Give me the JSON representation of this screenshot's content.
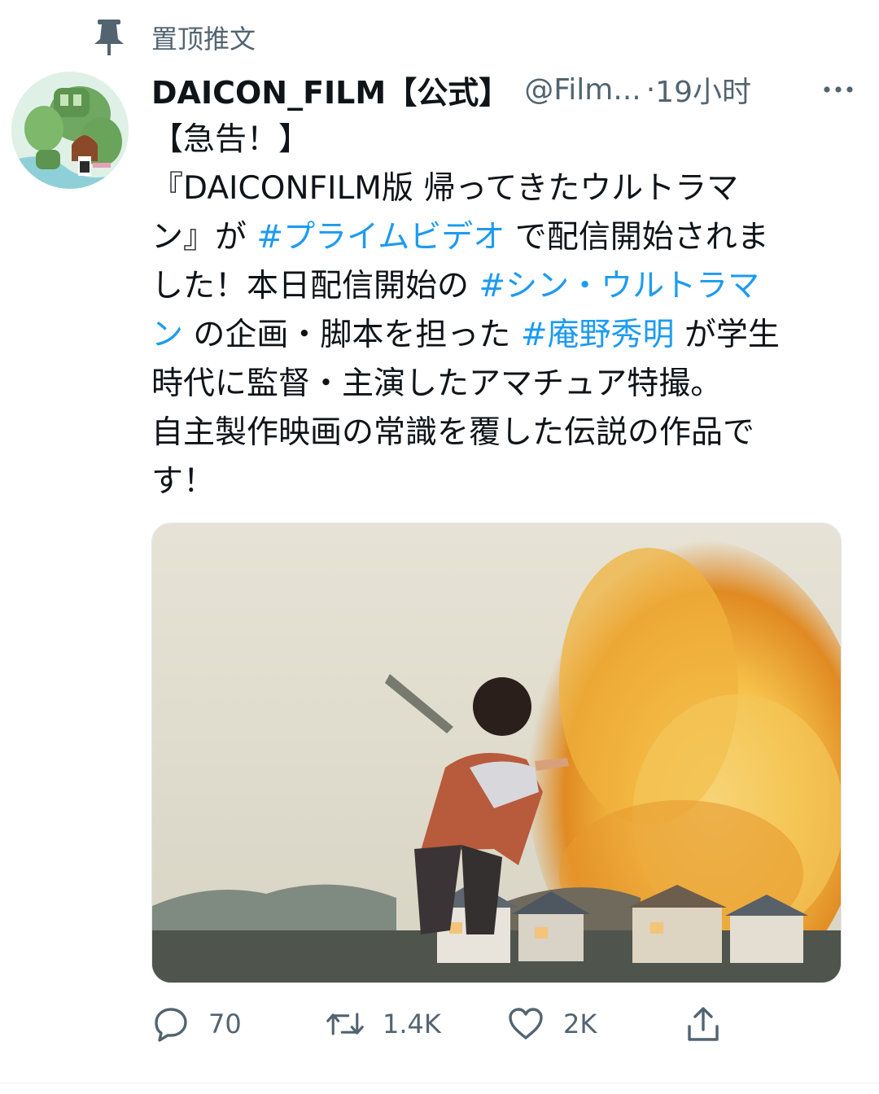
{
  "pinned": {
    "label": "置顶推文",
    "icon": "pin-icon"
  },
  "tweet": {
    "author": {
      "display_name": "DAICON_FILM【公式】",
      "handle": "@Film...",
      "avatar_icon": "avatar"
    },
    "separator": "·",
    "time": "19小时",
    "more_icon": "more-icon",
    "text_lines": [
      [
        {
          "t": "【急告！】"
        }
      ],
      [
        {
          "t": "『DAICONFILM版 帰ってきたウルトラマ"
        }
      ],
      [
        {
          "t": "ン』が "
        },
        {
          "t": "#プライムビデオ",
          "tag": true
        },
        {
          "t": " で配信開始されま"
        }
      ],
      [
        {
          "t": "した！本日配信開始の "
        },
        {
          "t": "#シン・ウルトラマ",
          "tag": true
        }
      ],
      [
        {
          "t": "ン",
          "tag": true
        },
        {
          "t": " の企画・脚本を担った "
        },
        {
          "t": "#庵野秀明",
          "tag": true
        },
        {
          "t": " が学生"
        }
      ],
      [
        {
          "t": "時代に監督・主演したアマチュア特撮。"
        }
      ],
      [
        {
          "t": "自主製作映画の常識を覆した伝説の作品で"
        }
      ],
      [
        {
          "t": "す！"
        }
      ]
    ],
    "media": {
      "type": "photo",
      "icon": "tweet-photo"
    },
    "actions": {
      "reply": {
        "icon": "reply-icon",
        "count": "70"
      },
      "retweet": {
        "icon": "retweet-icon",
        "count": "1.4K"
      },
      "like": {
        "icon": "heart-icon",
        "count": "2K"
      },
      "share": {
        "icon": "share-icon"
      }
    }
  },
  "colors": {
    "link": "#1d9bf0",
    "secondary": "#536471",
    "text": "#0f1419"
  }
}
